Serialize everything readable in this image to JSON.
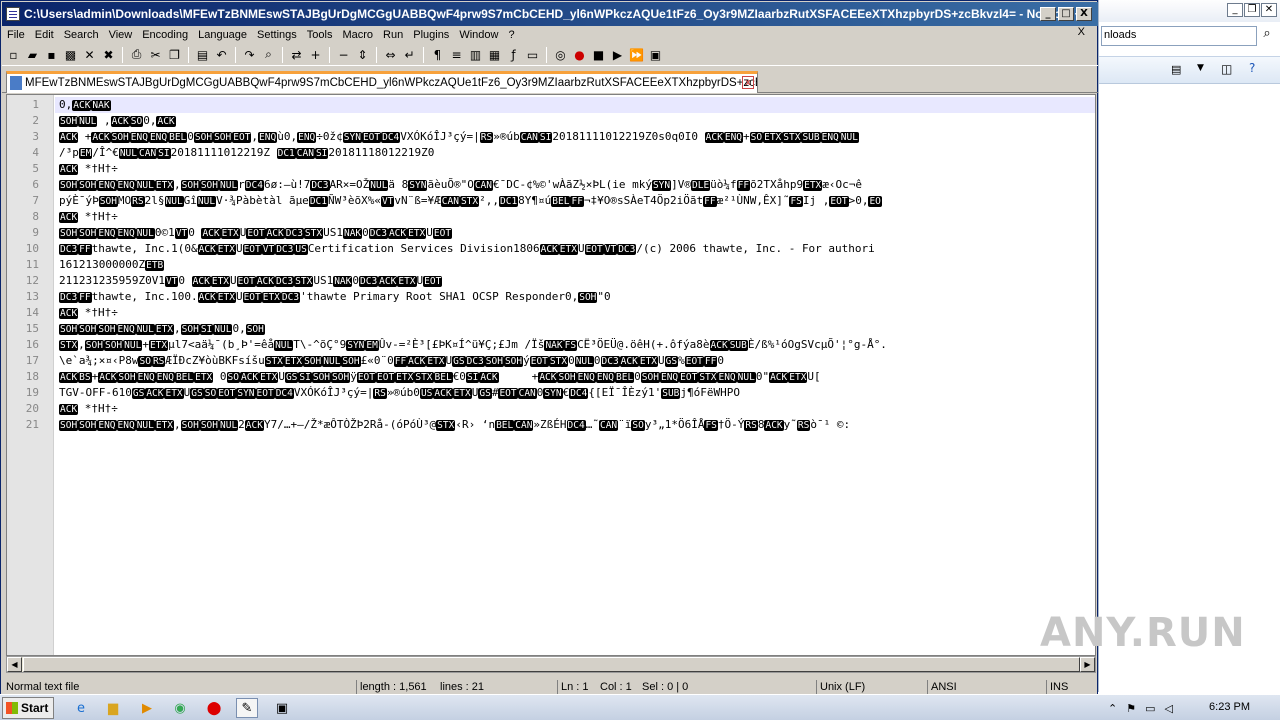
{
  "window": {
    "title": "C:\\Users\\admin\\Downloads\\MFEwTzBNMEswSTAJBgUrDgMCGgUABBQwF4prw9S7mCbCEHD_yl6nWPkczAQUe1tFz6_Oy3r9MZIaarbzRutXSFACEEeXTXhzpbyrDS+zcBkvzl4= - Notepad++",
    "min": "_",
    "max": "□",
    "close": "X"
  },
  "background_window": {
    "address": "nloads",
    "watermark": "ANY.RUN"
  },
  "menu": {
    "items": [
      "File",
      "Edit",
      "Search",
      "View",
      "Encoding",
      "Language",
      "Settings",
      "Tools",
      "Macro",
      "Run",
      "Plugins",
      "Window",
      "?"
    ],
    "close_doc": "X"
  },
  "toolbar": {
    "icons": [
      "new-file-icon",
      "open-file-icon",
      "save-icon",
      "save-all-icon",
      "close-icon",
      "close-all-icon",
      "print-icon",
      "cut-icon",
      "copy-icon",
      "paste-icon",
      "undo-icon",
      "redo-icon",
      "find-icon",
      "replace-icon",
      "zoom-in-icon",
      "zoom-out-icon",
      "sync-v-icon",
      "sync-h-icon",
      "wrap-icon",
      "all-chars-icon",
      "indent-guide-icon",
      "udl-icon",
      "doc-map-icon",
      "function-list-icon",
      "folder-icon",
      "monitor-icon",
      "record-icon",
      "stop-icon",
      "play-icon",
      "play-multi-icon",
      "save-macro-icon"
    ]
  },
  "tab": {
    "label": "MFEwTzBNMEswSTAJBgUrDgMCGgUABBQwF4prw9S7mCbCEHD_yl6nWPkczAQUe1tFz6_Oy3r9MZIaarbzRutXSFACEEeXTXhzpbyrDS+zcBkvzl4=",
    "close": "x"
  },
  "editor": {
    "lines": [
      {
        "n": "1",
        "t": "0,[ACK][NAK]"
      },
      {
        "n": "2",
        "t": "[SOH][NUL] ,[ACK][SO]0,[ACK]"
      },
      {
        "n": "3",
        "t": "[ACK] +[ACK][SOH][ENQ][ENQ][BEL]0[SOH][SOH][EOT],[ENQ]ù0,[ENQ]÷0ž¢[SYN][EOT][DC4]VXÓKóÎJ³çý=|[RS]»®úb[CAN][SI]20181111012219Z0s0q0I0 [ACK][ENQ]+[SO][ETX][STX][SUB][ENQ][NUL]"
      },
      {
        "n": "4",
        "t": "/³p[EM]/Î^€[NUL][CAN][SI]20181111012219Z [DC1][CAN][SI]20181118012219Z0"
      },
      {
        "n": "5",
        "t": "[ACK] *†H†÷"
      },
      {
        "n": "6",
        "t": "[SOH][SOH][ENQ][ENQ][NUL][ETX],[SOH][SOH][NUL]r[DC4]6ø:–ù!7[DC3]AR×=OŽ[NUL]ä 8[SYN]ãèuÕ®\"O[CAN]€¯DC-¢%©'wÀãZ½×ÞL(ie mký[SYN]]V®[DLE]üò¼f[FF]õ2TXåhp9[ETX]æ‹Oc¬ê"
      },
      {
        "n": "7",
        "t": "pýÈ¯ýÞ[SOH]MO[RS]2l§[NUL]Gî[NUL]V·¾Pàbètàl ãµe[DC1]ÑW³èõX%«[VT]vN¨ß=¥Æ[CAN][STX]²,‚[DC1]8Y¶¤ú[BEL][FF]¬‡¥O®sSÀeT4Öp2iÖãt[FF]æ²¹ÙNW‚ÊX]˜[FS]Ij ,[EOT]>0,[EO]"
      },
      {
        "n": "8",
        "t": "[ACK] *†H†÷"
      },
      {
        "n": "9",
        "t": "[SOH][SOH][ENQ][ENQ][NUL]0©1[VT]0 [ACK][ETX]U[EOT][ACK][DC3][STX]US1[NAK]0[DC3][ACK][ETX]U[EOT]"
      },
      {
        "n": "10",
        "t": "[DC3][FF]thawte, Inc.1(0&[ACK][ETX]U[EOT][VT][DC3][US]Certification Services Division1806[ACK][ETX]U[EOT][VT][DC3]/(c) 2006 thawte, Inc. - For authori"
      },
      {
        "n": "11",
        "t": "161213000000Z[ETB]"
      },
      {
        "n": "12",
        "t": "211231235959Z0V1[VT]0 [ACK][ETX]U[EOT][ACK][DC3][STX]US1[NAK]0[DC3][ACK][ETX]U[EOT]"
      },
      {
        "n": "13",
        "t": "[DC3][FF]thawte, Inc.100.[ACK][ETX]U[EOT][ETX][DC3]'thawte Primary Root SHA1 OCSP Responder0,[SOH]\"0"
      },
      {
        "n": "14",
        "t": "[ACK] *†H†÷"
      },
      {
        "n": "15",
        "t": "[SOH][SOH][SOH][ENQ][NUL][ETX],[SOH][SI][NUL]0,[SOH]"
      },
      {
        "n": "16",
        "t": "[STX],[SOH][SOH][NUL]+[ETX]µl7<aä¼¯(b¸Þ'=êå[NUL]T\\-^õÇ°9[SYN][EM]Ûv-=²È³[£ÞK¤Í^ü¥Ç;£Jm /Ïš[NAK][FS]CË³ÖEÜ@.öêH(+.ôfýa8è[ACK][SUB]È/ß%¹óOgSVcµÕ'¦°g-Å°."
      },
      {
        "n": "17",
        "t": "\\e`a¾;×¤‹P8w[SO][RS]ÆÏÐcZ¥òùBKFsíšu[STX][ETX][SOH][NUL][SOH]£«0¨0[FF][ACK][ETX]U[GS][DC3][SOH][SOH]ý[EOT][STX]0[NUL]0[DC3][ACK][ETX]U[GS]%[EOT][FF]0"
      },
      {
        "n": "18",
        "t": "[ACK][BS]+[ACK][SOH][ENQ][ENQ][BEL][ETX] 0[SO][ACK][ETX]U[GS][SI][SOH][SOH]ÿ[EOT][EOT][ETX][STX][BEL]€0[SI][ACK]     +[ACK][SOH][ENQ][ENQ][BEL]0[SOH][ENQ][EOT][STX][ENQ][NUL]0\"[ACK][ETX]U["
      },
      {
        "n": "19",
        "t": "TGV-OFF-610[GS][ACK][ETX]U[GS][SO][EOT][SYN][EOT][DC4]VXÓKóÎJ³çý=|[RS]»®úb0[US][ACK][ETX]U[GS]#[EOT][CAN]0[SYN]€[DC4]{[EÏ¯ÎÈzý1'[SUB]j¶óFëWHPO"
      },
      {
        "n": "20",
        "t": "[ACK] *†H†÷"
      },
      {
        "n": "21",
        "t": "[SOH][SOH][ENQ][ENQ][NUL][ETX],[SOH][SOH][NUL]2[ACK]Y7/…+—/Ž*æÔTÒŽÞ2Rå-(óPóÙ³@[STX]‹R› ‘n[BEL][CAN]»ZßÉH[DC4]…˜[CAN]¨ï[SO]y³„1*Ö6ÎÅ[FS]†Ö-Ý[RS]8[ACK]y˜[RS]ò¯¹ ©:"
      }
    ]
  },
  "status": {
    "type": "Normal text file",
    "length": "length : 1,561",
    "lines": "lines : 21",
    "ln": "Ln : 1",
    "col": "Col : 1",
    "sel": "Sel : 0 | 0",
    "eol": "Unix (LF)",
    "encoding": "ANSI",
    "mode": "INS"
  },
  "taskbar": {
    "start": "Start",
    "clock": "6:23 PM"
  }
}
